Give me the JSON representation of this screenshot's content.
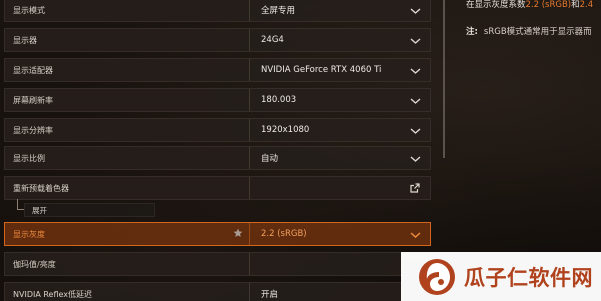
{
  "settings": {
    "rows": [
      {
        "label": "显示模式",
        "value": "全屏专用"
      },
      {
        "label": "显示器",
        "value": "24G4"
      },
      {
        "label": "显示适配器",
        "value": "NVIDIA GeForce RTX 4060 Ti"
      },
      {
        "label": "屏幕刷新率",
        "value": "180.003"
      },
      {
        "label": "显示分辨率",
        "value": "1920x1080"
      },
      {
        "label": "显示比例",
        "value": "自动"
      },
      {
        "label": "重新预载着色器",
        "value": ""
      },
      {
        "label": "显示灰度",
        "value": "2.2 (sRGB)"
      },
      {
        "label": "伽玛值/亮度",
        "value": ""
      },
      {
        "label": "NVIDIA Reflex低延迟",
        "value": "开启"
      }
    ],
    "expand_label": "展开",
    "active_index": 7
  },
  "info": {
    "line1_prefix": "在显示灰度系数",
    "line1_hl1": "2.2 (sRGB)",
    "line1_mid": "和",
    "line1_hl2": "2.4",
    "note_label": "注:",
    "note_text": "sRGB模式通常用于显示器而"
  },
  "watermark": {
    "text": "瓜子仁软件网"
  },
  "colors": {
    "accent": "#d2661c",
    "accent_text": "#f08b3c",
    "row_bg": "#261f1b",
    "page_bg": "#15100c"
  },
  "icons": {
    "dropdown": "chevron-down-icon",
    "external": "external-link-icon",
    "favorite": "star-icon"
  }
}
